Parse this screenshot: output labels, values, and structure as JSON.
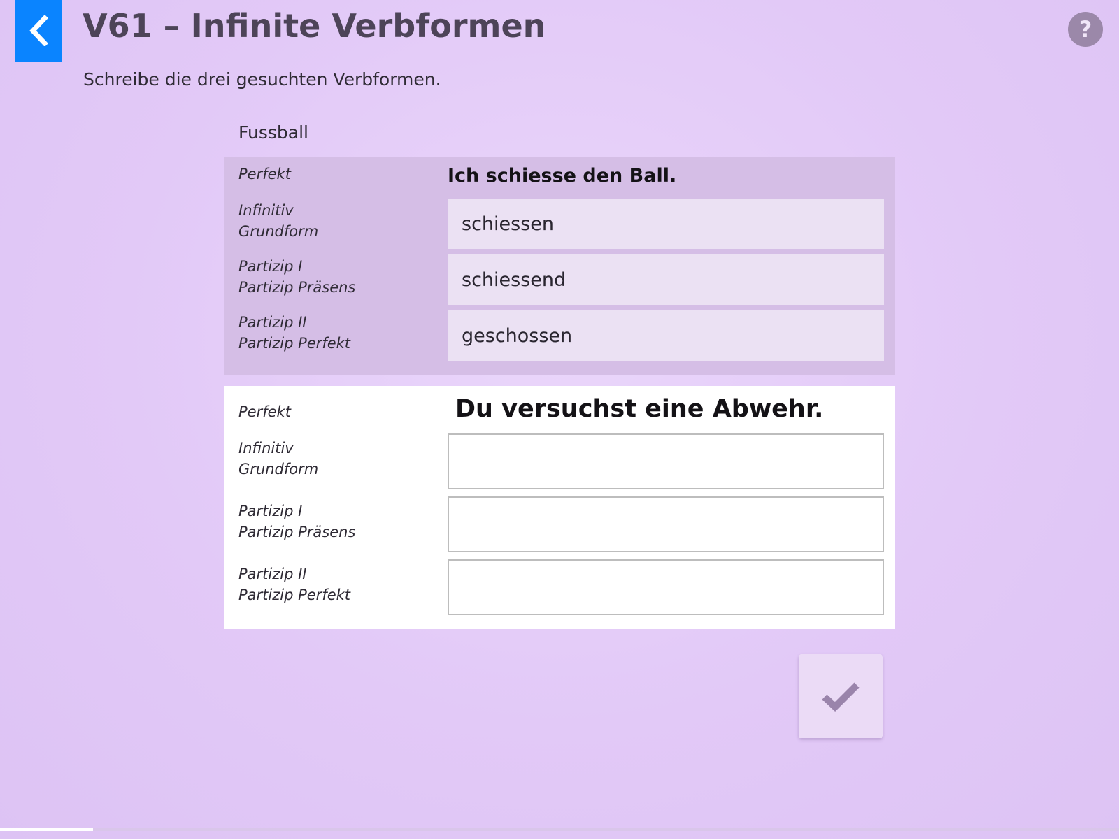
{
  "header": {
    "title": "V61 – Infinite Verbformen",
    "back_icon": "chevron-left-icon",
    "help_label": "?"
  },
  "instruction": "Schreibe die drei gesuchten Verbformen.",
  "exercise": {
    "topic": "Fussball",
    "items": [
      {
        "state": "completed",
        "tense_label": "Perfekt",
        "sentence": "Ich schiesse den Ball.",
        "forms": [
          {
            "label_1": "Infinitiv",
            "label_2": "Grundform",
            "value": "schiessen"
          },
          {
            "label_1": "Partizip I",
            "label_2": "Partizip Präsens",
            "value": "schiessend"
          },
          {
            "label_1": "Partizip II",
            "label_2": "Partizip Perfekt",
            "value": "geschossen"
          }
        ]
      },
      {
        "state": "active",
        "tense_label": "Perfekt",
        "sentence": "Du versuchst eine Abwehr.",
        "forms": [
          {
            "label_1": "Infinitiv",
            "label_2": "Grundform",
            "value": ""
          },
          {
            "label_1": "Partizip I",
            "label_2": "Partizip Präsens",
            "value": ""
          },
          {
            "label_1": "Partizip II",
            "label_2": "Partizip Perfekt",
            "value": ""
          }
        ]
      }
    ]
  },
  "check_button": {
    "icon": "checkmark-icon"
  },
  "progress": {
    "fraction": 0.083
  },
  "colors": {
    "accent_blue": "#0a84ff",
    "background": "#e2c9f7",
    "completed_card": "#d5bee6",
    "help_button": "#9b88a9",
    "title_text": "#4d4458"
  }
}
